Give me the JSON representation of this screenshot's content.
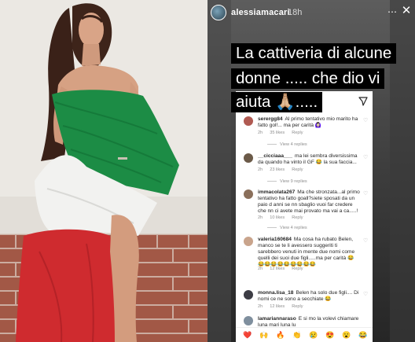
{
  "story": {
    "username": "alessiamacari",
    "time_ago": "18h",
    "caption_lines": [
      "La cattiveria di alcune",
      "donne ..... che dio vi",
      "aiuta 🙏🏼....."
    ]
  },
  "comments": [
    {
      "username": "serergg84",
      "text": "Al primo tentativo mio marito ha fatto gol!... ma per carità 🙆🏻‍♀️",
      "time": "2h",
      "likes": "35 likes",
      "reply": "Reply",
      "view_replies": "View 4 replies",
      "avatar_color": "#b05a52"
    },
    {
      "username": "__cicciaaa___",
      "text": "ma lei sembra diversissima da quando ha vinto il GF 😂 la sua faccia...",
      "time": "2h",
      "likes": "23 likes",
      "reply": "Reply",
      "view_replies": "View 9 replies",
      "avatar_color": "#6b5a48"
    },
    {
      "username": "immacolata267",
      "text": "Ma che stronzata...al primo tentativo ha fatto goall?siete sposati da un paio d anni se nn sbaglio vuoi far credere che nn ci avete mai provato ma vai a ca.....!",
      "time": "2h",
      "likes": "10 likes",
      "reply": "Reply",
      "view_replies": "View 4 replies",
      "avatar_color": "#8a6f5b"
    },
    {
      "username": "valeria160684",
      "text": "Ma cosa ha rubato Belen, manco se te li avessero suggeriti ti sarebbero venuti in mente due nomi come quelli dei suoi due figli.....ma per carità 😂😂😂😂😂😂😂😂😂😂",
      "time": "2h",
      "likes": "12 likes",
      "reply": "Reply",
      "view_replies": "",
      "avatar_color": "#c9a48c"
    },
    {
      "username": "monna.lisa_18",
      "text": "Belen ha solo due figli.... Di nomi ce ne sono a secchiate 😂",
      "time": "2h",
      "likes": "12 likes",
      "reply": "Reply",
      "view_replies": "",
      "avatar_color": "#3c3c44"
    },
    {
      "username": "lamariannaraso",
      "text": "E si mo la volevi chiamare luna mari luna lu",
      "time": "",
      "likes": "",
      "reply": "",
      "view_replies": "",
      "avatar_color": "#7f8f9e"
    }
  ],
  "reactions": [
    "❤️",
    "🙌",
    "🔥",
    "👏",
    "😢",
    "😍",
    "😮",
    "😂"
  ],
  "colors": {
    "flag_green": "#1c8c45",
    "flag_white": "#f2f2f0",
    "flag_red": "#cf2b2f",
    "brick": "#a45a48",
    "caption_bg": "#000000",
    "caption_text": "#ffffff"
  },
  "icons": {
    "more": "more-icon",
    "close": "close-icon",
    "share": "paper-plane-icon",
    "heart": "heart-outline-icon"
  }
}
